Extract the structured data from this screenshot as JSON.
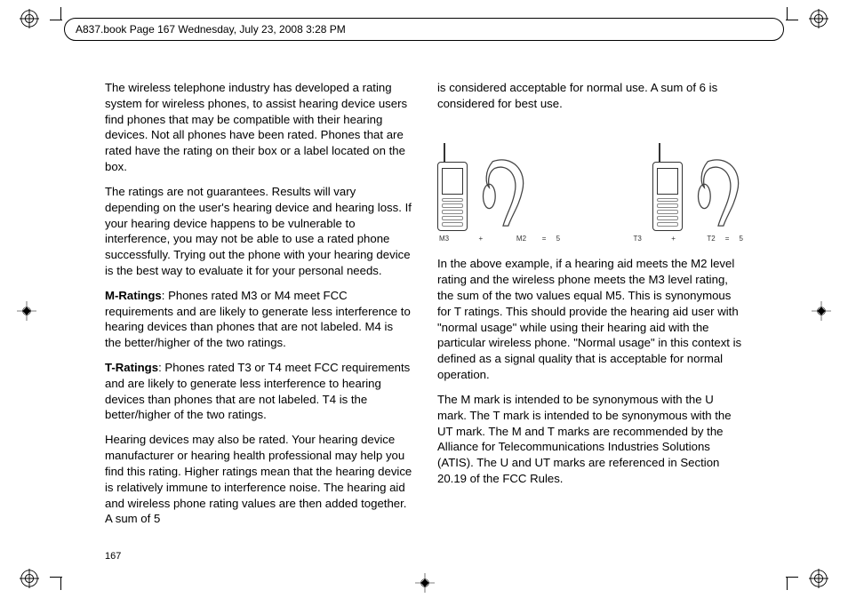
{
  "header": "A837.book  Page 167  Wednesday, July 23, 2008  3:28 PM",
  "page_number": "167",
  "left_col": {
    "p1": "The wireless telephone industry has developed a rating system for wireless phones, to assist hearing device users find phones that may be compatible with their hearing devices. Not all phones have been rated.  Phones that are rated have the rating on their box or a label located on the box.",
    "p2": "The ratings are not guarantees. Results will vary depending on the user's hearing device and hearing loss. If your hearing device happens to be vulnerable to interference, you may not be able to use a rated phone successfully. Trying out the phone with your hearing device is the best way to evaluate it for your personal needs.",
    "p3_label": "M-Ratings",
    "p3": ": Phones rated M3 or M4 meet FCC requirements and are likely to generate less interference to hearing devices than phones that are not labeled. M4 is the better/higher of the two ratings.",
    "p4_label": "T-Ratings",
    "p4": ": Phones rated T3 or T4 meet FCC requirements and are likely to generate less interference to hearing devices than phones that are not labeled. T4 is the better/higher of the two ratings.",
    "p5": "Hearing devices may also be rated. Your hearing device manufacturer or hearing health professional may help you find this rating. Higher ratings mean that the hearing device is relatively immune to interference noise. The hearing aid and wireless phone rating values are then added together. A sum of 5 "
  },
  "right_col": {
    "p1": "is considered acceptable for normal use. A sum of 6 is considered for best use.",
    "fig_caption_left": "M3               +                 M2        =     5",
    "fig_caption_right": "T3               +                T2     =     5",
    "p2": "In the above example, if a hearing aid meets the M2 level rating and the wireless phone meets the M3 level rating, the sum of the two values equal M5. This is synonymous for T ratings. This should provide the hearing aid user with \"normal usage\" while using their hearing aid with the particular wireless phone. \"Normal usage\" in this context is defined as a signal quality that is acceptable for normal operation.",
    "p3": "The M mark is intended to be synonymous with the U mark. The T mark is intended to be synonymous with the UT mark. The M and T marks are recommended by the Alliance for Telecommunications Industries Solutions (ATIS). The U and UT marks are referenced in Section 20.19 of the FCC Rules."
  }
}
